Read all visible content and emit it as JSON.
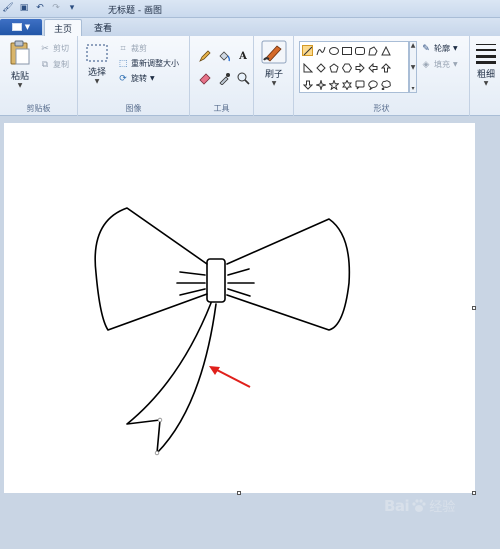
{
  "window": {
    "title": "无标题 - 画图"
  },
  "tabs": {
    "home": "主页",
    "view": "查看"
  },
  "clipboard": {
    "paste": "粘贴",
    "cut": "剪切",
    "copy": "复制",
    "label": "剪贴板"
  },
  "image": {
    "select": "选择",
    "crop": "裁剪",
    "resize": "重新调整大小",
    "rotate": "旋转",
    "label": "图像"
  },
  "tools": {
    "label": "工具"
  },
  "brushes": {
    "label": "刷子"
  },
  "shapes": {
    "outline": "轮廓",
    "fill": "填充",
    "label": "形状"
  },
  "size": {
    "label": "粗细"
  },
  "watermark": {
    "brand": "Bai 百 经验",
    "brand_left": "Bai",
    "brand_right": "经验"
  }
}
